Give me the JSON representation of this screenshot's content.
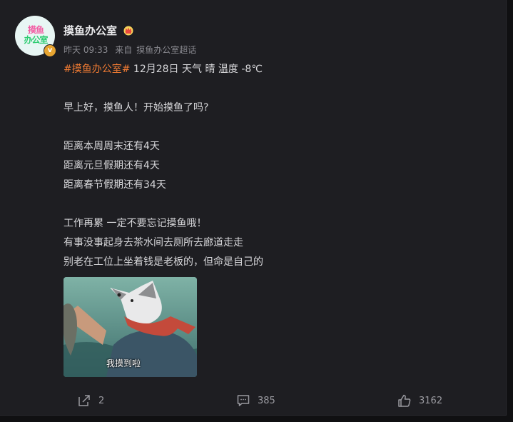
{
  "post": {
    "author": "摸鱼办公室",
    "avatar_text_line1": "摸鱼",
    "avatar_text_line2": "办公室",
    "verified_badge": "v",
    "time": "昨天 09:33",
    "source_prefix": "来自",
    "source": "摸鱼办公室超话",
    "hashtag": "#摸鱼办公室#",
    "first_line_rest": " 12月28日 天气 晴 温度 -8℃",
    "greeting": "早上好，摸鱼人！开始摸鱼了吗?",
    "countdowns": [
      "距离本周周末还有4天",
      "距离元旦假期还有4天",
      "距离春节假期还有34天"
    ],
    "closing": [
      "工作再累 一定不要忘记摸鱼哦！",
      "有事没事起身去茶水间去厕所去廊道走走",
      "别老在工位上坐着钱是老板的，但命是自己的"
    ],
    "image_caption": "我摸到啦"
  },
  "actions": {
    "share_count": "2",
    "comment_count": "385",
    "like_count": "3162"
  },
  "colors": {
    "background": "#1e1e22",
    "hashtag": "#ee7a33",
    "meta_text": "#8a8a90",
    "verified_badge": "#e8a531"
  },
  "icons": [
    "crown-icon",
    "share-icon",
    "comment-icon",
    "like-icon"
  ]
}
